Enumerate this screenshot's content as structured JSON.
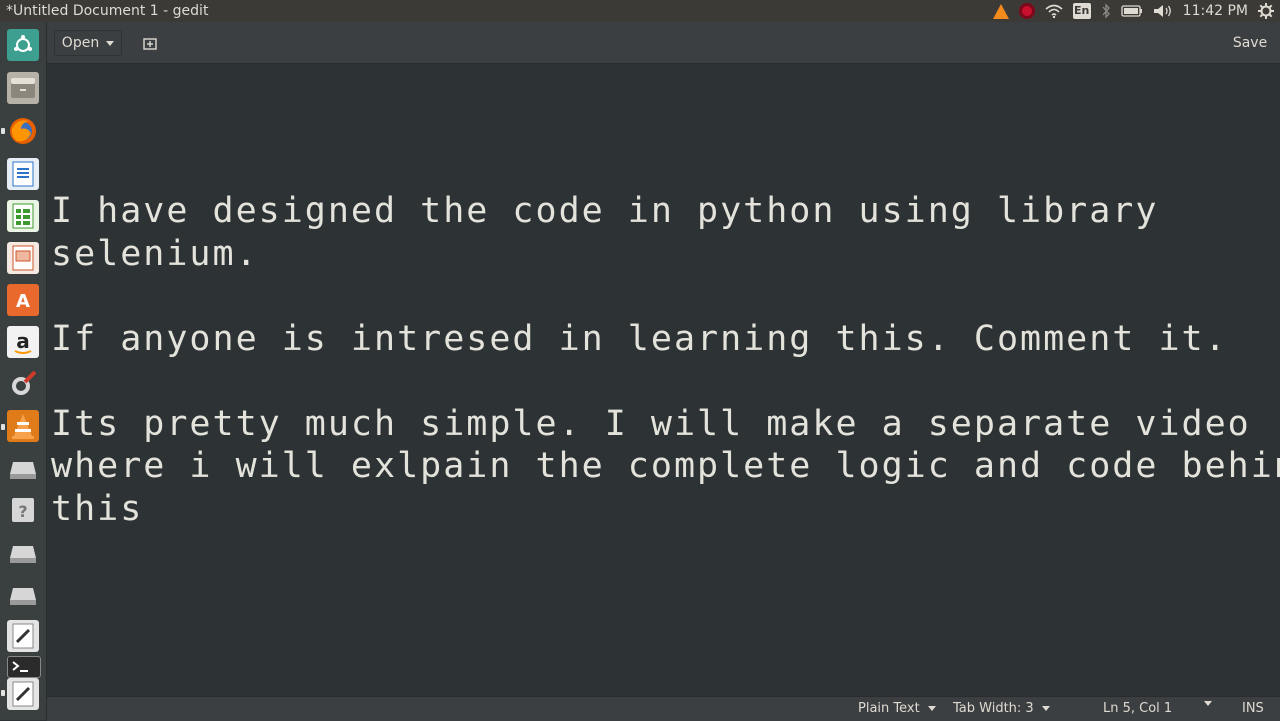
{
  "window": {
    "title": "*Untitled Document 1 - gedit"
  },
  "tray": {
    "clock": "11:42 PM",
    "keyboard_layout": "En"
  },
  "toolbar": {
    "open_label": "Open",
    "save_label": "Save"
  },
  "document": {
    "lines": [
      "I have designed the code in python using library",
      "selenium.",
      "",
      "If anyone is intresed in learning this. Comment it.",
      "",
      "Its pretty much simple. I will make a separate video",
      "where i will exlpain the complete logic and code behind",
      "this"
    ]
  },
  "statusbar": {
    "language": "Plain Text",
    "tab_width": "Tab Width: 3",
    "cursor_position": "Ln 5, Col 1",
    "insert_mode": "INS"
  },
  "launcher": {
    "apps": [
      "dash-icon",
      "files-icon",
      "firefox-icon",
      "writer-icon",
      "calc-icon",
      "impress-icon",
      "software-center-icon",
      "amazon-icon",
      "system-settings-icon",
      "vlc-icon",
      "drive-icon",
      "help-icon",
      "drive-icon",
      "drive-icon",
      "text-editor-icon",
      "terminal-icon",
      "text-editor-icon"
    ]
  },
  "colors": {
    "editor_bg": "#2d3234",
    "panel_bg": "#3b3a37",
    "text": "#e3e3dc"
  }
}
